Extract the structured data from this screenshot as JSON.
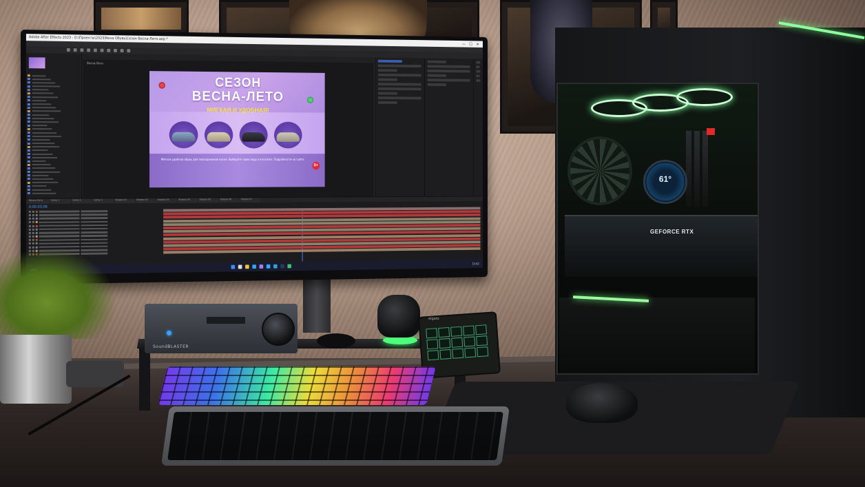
{
  "app": {
    "window_title": "Adobe After Effects 2023 - D:\\Проекты\\2023\\Nova Обувь\\Сезон Весна-Лето.aep *",
    "window_controls": [
      "—",
      "☐",
      "✕"
    ],
    "menu": [
      "File",
      "Edit",
      "Composition",
      "Layer",
      "Effect",
      "Animation",
      "View",
      "Window",
      "Help"
    ],
    "comp_tab": "Весна-Лето",
    "timecode": "0:00:03:08",
    "timeline_tabs": [
      "Весна-Лето",
      "Comp 1",
      "Comp 2",
      "Comp 3",
      "Shapes 01",
      "Shapes 02",
      "Shapes 03",
      "Shapes 04",
      "Shapes 05",
      "Shapes 06",
      "Shapes 07"
    ]
  },
  "banner": {
    "title_line1": "СЕЗОН",
    "title_line2": "ВЕСНА-ЛЕТО",
    "subtitle": "МЯГКАЯ И УДОБНАЯ!",
    "badge": "0+",
    "disclaimer": "Мягкая удобная обувь для повседневной носки. Выберите свою пару в каталоге. Подробности на сайте."
  },
  "taskbar": {
    "weather": "+6°C",
    "clock": "15:42"
  },
  "hardware": {
    "pump_display": "61°",
    "gpu_label": "GEFORCE RTX",
    "amp_label": "SoundBLASTER",
    "streamdeck_label": "elgato"
  },
  "colors": {
    "accent_green": "#7dff9a",
    "banner_purple": "#b79ae8",
    "banner_yellow": "#f6e04b"
  }
}
